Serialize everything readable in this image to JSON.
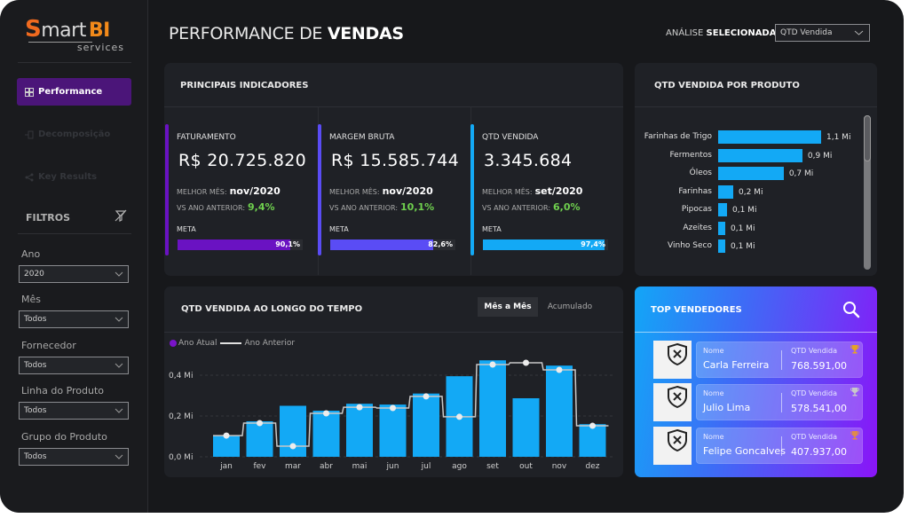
{
  "app": {
    "logo": {
      "s": "S",
      "mart": "mart",
      "bi": "BI",
      "sub": "services"
    },
    "title_light": "PERFORMANCE DE ",
    "title_bold": "VENDAS"
  },
  "nav": {
    "items": [
      {
        "label": "Performance",
        "icon": "grid-icon",
        "active": true
      },
      {
        "label": "Decomposição",
        "icon": "decomposition-tree-icon",
        "active": false
      },
      {
        "label": "Key Results",
        "icon": "share-nodes-icon",
        "active": false
      }
    ]
  },
  "filters": {
    "title": "FILTROS",
    "clear_icon": "eraser-filter-icon",
    "items": [
      {
        "label": "Ano",
        "value": "2020"
      },
      {
        "label": "Mês",
        "value": "Todos"
      },
      {
        "label": "Fornecedor",
        "value": "Todos"
      },
      {
        "label": "Linha do Produto",
        "value": "Todos"
      },
      {
        "label": "Grupo do Produto",
        "value": "Todos"
      }
    ]
  },
  "analysis": {
    "label_light": "ANÁLISE ",
    "label_bold": "SELECIONADA:",
    "value": "QTD Vendida"
  },
  "kpis": {
    "title": "PRINCIPAIS INDICADORES",
    "best_label": "MELHOR MÊS:",
    "vs_label": "VS ANO ANTERIOR:",
    "meta_label": "META",
    "items": [
      {
        "name": "FATURAMENTO",
        "value": "R$ 20.725.820",
        "best_month": "nov/2020",
        "vs_prev": "9,4%",
        "meta_pct": 90.1,
        "meta_text": "90,1%",
        "color": "#6a12c2"
      },
      {
        "name": "MARGEM BRUTA",
        "value": "R$ 15.585.744",
        "best_month": "nov/2020",
        "vs_prev": "10,1%",
        "meta_pct": 82.6,
        "meta_text": "82,6%",
        "color": "#5a4cf5"
      },
      {
        "name": "QTD VENDIDA",
        "value": "3.345.684",
        "best_month": "set/2020",
        "vs_prev": "6,0%",
        "meta_pct": 97.4,
        "meta_text": "97,4%",
        "color": "#13a9f5"
      }
    ]
  },
  "product_panel": {
    "title": "QTD VENDIDA POR PRODUTO"
  },
  "time_panel": {
    "title": "QTD VENDIDA AO LONGO DO TEMPO",
    "toggle_on": "Mês a Mês",
    "toggle_off": "Acumulado",
    "legend_current": "Ano Atual",
    "legend_previous": "Ano Anterior"
  },
  "top_sellers": {
    "title": "TOP VENDEDORES",
    "name_label": "Nome",
    "qty_label": "QTD Vendida",
    "items": [
      {
        "name": "Carla Ferreira",
        "qty": "768.591,00",
        "trophy": "gold",
        "trophy_color": "#e6a325"
      },
      {
        "name": "Julio Lima",
        "qty": "578.541,00",
        "trophy": "silver",
        "trophy_color": "#c9c9c9"
      },
      {
        "name": "Felipe Goncalves",
        "qty": "407.937,00",
        "trophy": "bronze",
        "trophy_color": "#e08a4a"
      }
    ]
  },
  "chart_data": [
    {
      "type": "bar",
      "orientation": "horizontal",
      "title": "QTD VENDIDA POR PRODUTO",
      "categories": [
        "Farinhas de Trigo",
        "Fermentos",
        "Óleos",
        "Farinhas",
        "Pipocas",
        "Azeites",
        "Vinho Seco"
      ],
      "values": [
        1.1,
        0.9,
        0.7,
        0.2,
        0.1,
        0.1,
        0.1
      ],
      "value_labels": [
        "1,1 Mi",
        "0,9 Mi",
        "0,7 Mi",
        "0,2 Mi",
        "0,1 Mi",
        "0,1 Mi",
        "0,1 Mi"
      ],
      "unit": "Mi",
      "bar_color": "#13a9f5"
    },
    {
      "type": "bar",
      "title": "QTD VENDIDA AO LONGO DO TEMPO",
      "categories": [
        "jan",
        "fev",
        "mar",
        "abr",
        "mai",
        "jun",
        "jul",
        "ago",
        "set",
        "out",
        "nov",
        "dez"
      ],
      "series": [
        {
          "name": "Ano Atual",
          "type": "bar",
          "color": "#13a9f5",
          "values": [
            0.104,
            0.174,
            0.25,
            0.226,
            0.26,
            0.256,
            0.31,
            0.395,
            0.473,
            0.287,
            0.447,
            0.16
          ]
        },
        {
          "name": "Ano Anterior",
          "type": "step-line",
          "color": "#e0e0e0",
          "values": [
            0.104,
            0.165,
            0.052,
            0.213,
            0.243,
            0.239,
            0.296,
            0.196,
            0.452,
            0.461,
            0.426,
            0.152
          ]
        }
      ],
      "yticks": [
        "0,0 Mi",
        "0,2 Mi",
        "0,4 Mi"
      ],
      "ytick_values": [
        0,
        0.2,
        0.4
      ],
      "ylim": [
        0,
        0.5
      ],
      "unit": "Mi",
      "grid": true,
      "legend": "top-left"
    }
  ]
}
